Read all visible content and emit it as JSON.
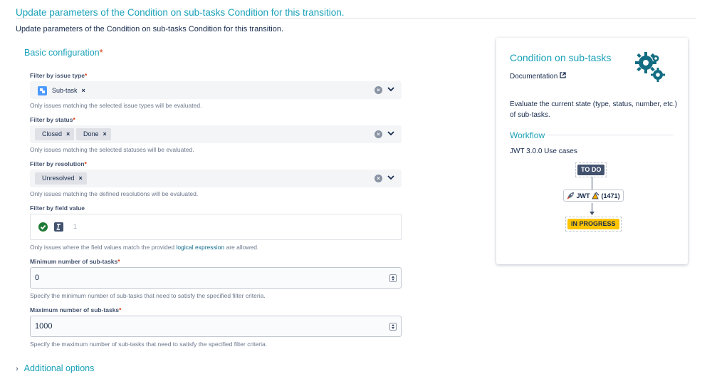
{
  "header": {
    "title": "Update parameters of the Condition on sub-tasks Condition for this transition.",
    "subtitle": "Update parameters of the Condition on sub-tasks Condition for this transition."
  },
  "basic": {
    "heading": "Basic configuration",
    "required_mark": "*"
  },
  "fields": {
    "issue_type": {
      "label": "Filter by issue type",
      "required": "*",
      "tags": [
        "Sub-task"
      ],
      "help": "Only issues matching the selected issue types will be evaluated."
    },
    "status": {
      "label": "Filter by status",
      "required": "*",
      "tags": [
        "Closed",
        "Done"
      ],
      "help": "Only issues matching the selected statuses will be evaluated."
    },
    "resolution": {
      "label": "Filter by resolution",
      "required": "*",
      "tags": [
        "Unresolved"
      ],
      "help": "Only issues matching the defined resolutions will be evaluated."
    },
    "field_value": {
      "label": "Filter by field value",
      "line_number": "1",
      "help_before": "Only issues where the field values match the provided ",
      "help_link": "logical expression",
      "help_after": " are allowed."
    },
    "min_subtasks": {
      "label": "Minimum number of sub-tasks",
      "required": "*",
      "value": "0",
      "help": "Specify the minimum number of sub-tasks that need to satisfy the specified filter criteria."
    },
    "max_subtasks": {
      "label": "Maximum number of sub-tasks",
      "required": "*",
      "value": "1000",
      "help": "Specify the maximum number of sub-tasks that need to satisfy the specified filter criteria."
    }
  },
  "additional": {
    "label": "Additional options"
  },
  "card": {
    "title": "Condition on sub-tasks",
    "doc_link": "Documentation",
    "description": "Evaluate the current state (type, status, number, etc.) of sub-tasks.",
    "workflow_heading": "Workflow",
    "use_cases": "JWT 3.0.0 Use cases",
    "status_from": "TO DO",
    "transition_label": "JWT",
    "transition_id": "(1471)",
    "status_to": "IN PROGRESS"
  },
  "colors": {
    "accent": "#1aa1b8",
    "required": "#de350b",
    "todo": "#42526e",
    "in_progress": "#ffc400",
    "icon_teal": "#136d82"
  },
  "icons": {
    "clear": "clear-circle-icon",
    "dropdown": "chevron-down-icon",
    "valid": "check-circle-icon",
    "expression_type": "expression-icon",
    "external_link": "external-link-icon",
    "gears": "gears-icon",
    "rocket": "rocket-icon"
  }
}
